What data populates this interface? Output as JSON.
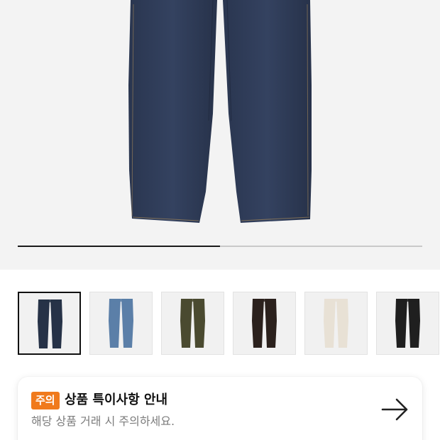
{
  "product": {
    "image_progress": 0.5
  },
  "thumbnails": [
    {
      "color_name": "navy-dark",
      "fill": "#263247",
      "active": true
    },
    {
      "color_name": "light-blue",
      "fill": "#5b7fa8",
      "active": false
    },
    {
      "color_name": "olive",
      "fill": "#4a4a30",
      "active": false
    },
    {
      "color_name": "brown-black",
      "fill": "#2b211d",
      "active": false
    },
    {
      "color_name": "ivory",
      "fill": "#e8e1d5",
      "active": false
    },
    {
      "color_name": "black",
      "fill": "#1f1f1f",
      "active": false
    }
  ],
  "notice": {
    "badge": "주의",
    "title": "상품 특이사항 안내",
    "description": "해당 상품 거래 시 주의하세요.",
    "arrow_icon": "arrow-right-icon",
    "badge_color": "#f07a1c"
  }
}
